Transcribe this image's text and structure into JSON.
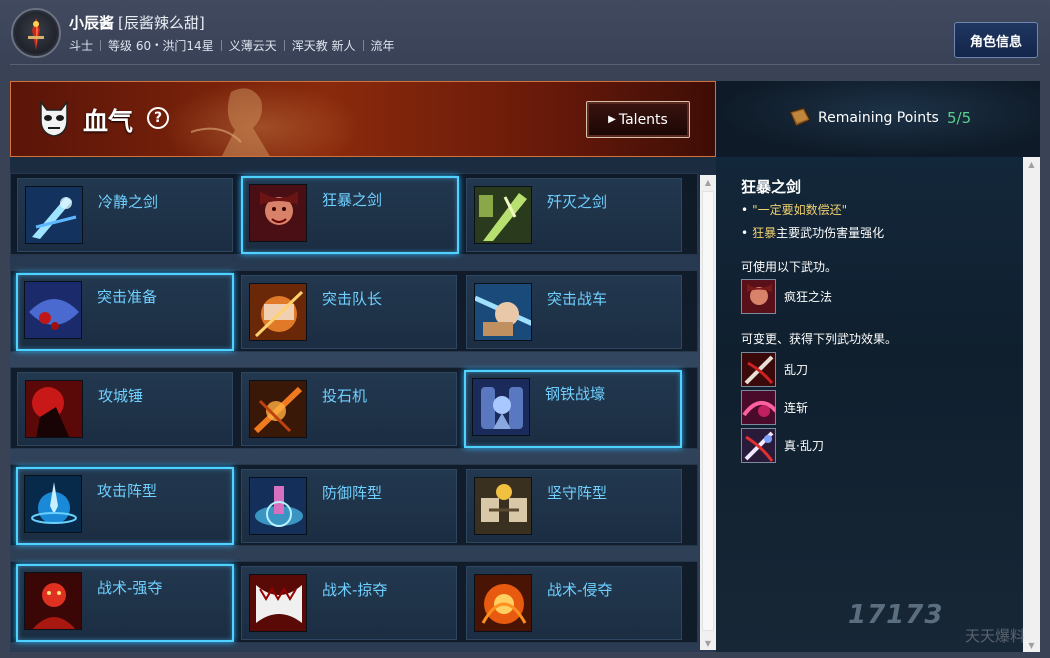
{
  "header": {
    "name": "小辰酱",
    "guild_tag": "[辰酱辣么甜]",
    "meta": [
      "斗士",
      "等级 60",
      "洪门14星",
      "义薄云天",
      "浑天教 新人",
      "流年"
    ],
    "info_button": "角色信息"
  },
  "banner": {
    "title": "血气",
    "help": "?",
    "talents_button": "Talents"
  },
  "points": {
    "label": "Remaining Points",
    "value": "5/5"
  },
  "grid": {
    "rows": [
      [
        {
          "label": "冷静之剑",
          "icon": "calm-sword-icon",
          "selected": false
        },
        {
          "label": "狂暴之剑",
          "icon": "berserk-sword-icon",
          "selected": true
        },
        {
          "label": "歼灭之剑",
          "icon": "annihilate-sword-icon",
          "selected": false
        }
      ],
      [
        {
          "label": "突击准备",
          "icon": "assault-prep-icon",
          "selected": true
        },
        {
          "label": "突击队长",
          "icon": "assault-captain-icon",
          "selected": false
        },
        {
          "label": "突击战车",
          "icon": "assault-chariot-icon",
          "selected": false
        }
      ],
      [
        {
          "label": "攻城锤",
          "icon": "battering-ram-icon",
          "selected": false
        },
        {
          "label": "投石机",
          "icon": "catapult-icon",
          "selected": false
        },
        {
          "label": "钢铁战壕",
          "icon": "steel-trench-icon",
          "selected": true
        }
      ],
      [
        {
          "label": "攻击阵型",
          "icon": "attack-formation-icon",
          "selected": true
        },
        {
          "label": "防御阵型",
          "icon": "defense-formation-icon",
          "selected": false
        },
        {
          "label": "坚守阵型",
          "icon": "hold-formation-icon",
          "selected": false
        }
      ],
      [
        {
          "label": "战术-强夺",
          "icon": "tactic-seize-icon",
          "selected": true
        },
        {
          "label": "战术-掠夺",
          "icon": "tactic-plunder-icon",
          "selected": false
        },
        {
          "label": "战术-侵夺",
          "icon": "tactic-invade-icon",
          "selected": false
        }
      ]
    ]
  },
  "detail": {
    "title": "狂暴之剑",
    "quote": "\"一定要如数偿还\"",
    "desc_highlight": "狂暴",
    "desc_rest": "主要武功伤害量强化",
    "section1": "可使用以下武功。",
    "skills1": [
      {
        "name": "疯狂之法",
        "icon": "mad-method-icon"
      }
    ],
    "section2": "可变更、获得下列武功效果。",
    "skills2": [
      {
        "name": "乱刀",
        "icon": "random-blade-icon"
      },
      {
        "name": "连斩",
        "icon": "chain-slash-icon"
      },
      {
        "name": "真·乱刀",
        "icon": "true-random-blade-icon"
      }
    ]
  },
  "watermark": {
    "text": "17173",
    "text2": "天天爆料"
  },
  "colors": {
    "accent_blue": "#4fd2ff",
    "skill_label": "#6fd0ff",
    "points_green": "#58d08a",
    "quote_gold": "#f0d070",
    "banner_red": "#8a2a0c"
  }
}
